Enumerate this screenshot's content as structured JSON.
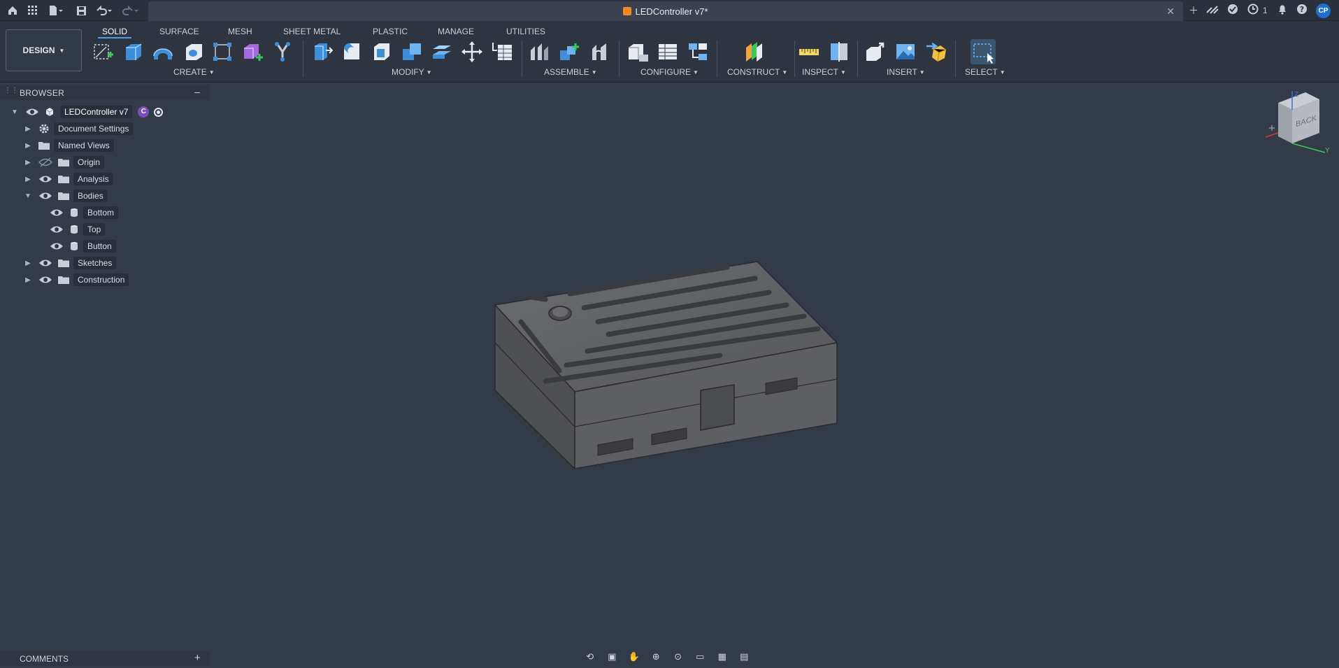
{
  "topbar": {
    "document_title": "LEDController v7*",
    "job_count": "1",
    "avatar_initials": "CP"
  },
  "workspace": {
    "mode_label": "DESIGN",
    "tabs": [
      "SOLID",
      "SURFACE",
      "MESH",
      "SHEET METAL",
      "PLASTIC",
      "MANAGE",
      "UTILITIES"
    ],
    "active_tab": "SOLID"
  },
  "toolbar_groups": {
    "create": "CREATE",
    "modify": "MODIFY",
    "assemble": "ASSEMBLE",
    "configure": "CONFIGURE",
    "construct": "CONSTRUCT",
    "inspect": "INSPECT",
    "insert": "INSERT",
    "select": "SELECT"
  },
  "browser": {
    "title": "BROWSER",
    "root": {
      "label": "LEDController v7",
      "badge": "C"
    },
    "items": [
      {
        "label": "Document Settings"
      },
      {
        "label": "Named Views"
      },
      {
        "label": "Origin"
      },
      {
        "label": "Analysis"
      },
      {
        "label": "Bodies"
      },
      {
        "label": "Bottom"
      },
      {
        "label": "Top"
      },
      {
        "label": "Button"
      },
      {
        "label": "Sketches"
      },
      {
        "label": "Construction"
      }
    ]
  },
  "comments": {
    "title": "COMMENTS"
  },
  "viewcube": {
    "face_label": "BACK",
    "axis_z": "Z",
    "axis_y": "Y"
  },
  "colors": {
    "canvas": "#333b48",
    "toolbar": "#2e3540",
    "topbar": "#2a313c",
    "accent": "#4a9cf0",
    "model_grey": "#5a5c60"
  }
}
